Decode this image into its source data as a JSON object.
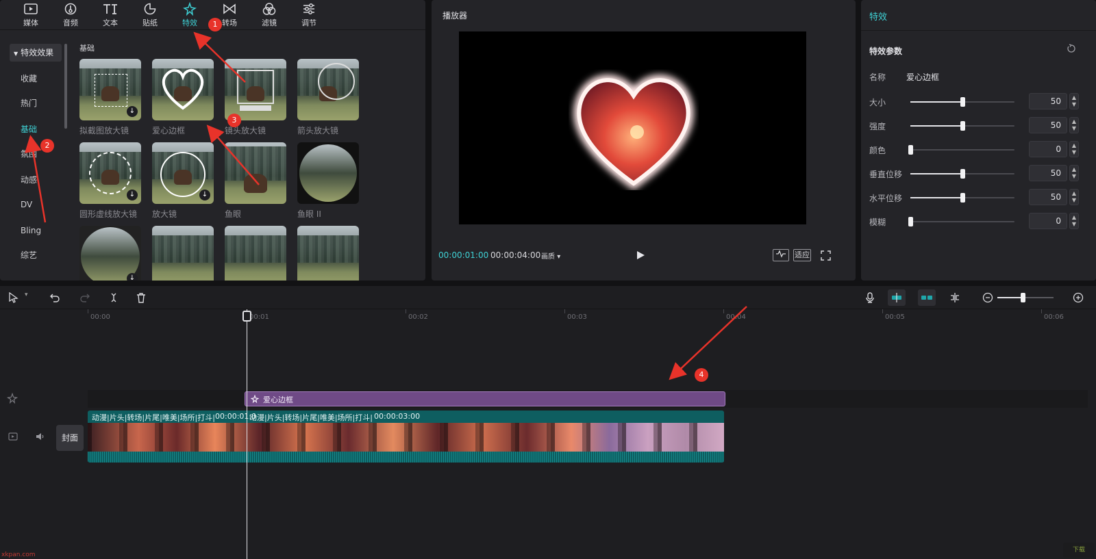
{
  "top_tabs": [
    {
      "label": "媒体",
      "icon": "media-icon"
    },
    {
      "label": "音频",
      "icon": "audio-icon"
    },
    {
      "label": "文本",
      "icon": "text-icon"
    },
    {
      "label": "贴纸",
      "icon": "sticker-icon"
    },
    {
      "label": "特效",
      "icon": "effects-icon",
      "active": true
    },
    {
      "label": "转场",
      "icon": "transition-icon"
    },
    {
      "label": "滤镜",
      "icon": "filter-icon"
    },
    {
      "label": "调节",
      "icon": "adjust-icon"
    }
  ],
  "sidebar": {
    "header": "特效效果",
    "items": [
      "收藏",
      "热门",
      "基础",
      "氛围",
      "动感",
      "DV",
      "Bling",
      "综艺"
    ],
    "active": "基础"
  },
  "effects_grid": {
    "section_title": "基础",
    "cards": [
      {
        "label": "拟截图放大镜",
        "downloadable": true
      },
      {
        "label": "爱心边框",
        "downloadable": false
      },
      {
        "label": "镜头放大镜",
        "downloadable": false
      },
      {
        "label": "箭头放大镜",
        "downloadable": false
      },
      {
        "label": "圆形虚线放大镜",
        "downloadable": true
      },
      {
        "label": "放大镜",
        "downloadable": true
      },
      {
        "label": "鱼眼",
        "downloadable": false
      },
      {
        "label": "鱼眼 II",
        "downloadable": false
      },
      {
        "label": "",
        "downloadable": true
      },
      {
        "label": "",
        "downloadable": false
      },
      {
        "label": "",
        "downloadable": false
      },
      {
        "label": "",
        "downloadable": false
      }
    ]
  },
  "player": {
    "title": "播放器",
    "current_time": "00:00:01:00",
    "total_time": "00:00:04:00",
    "quality_label": "画质",
    "fit_label": "适应"
  },
  "effect_panel": {
    "title": "特效",
    "section_title": "特效参数",
    "name_label": "名称",
    "name_value": "爱心边框",
    "params": [
      {
        "label": "大小",
        "value": "50",
        "level": 0.5
      },
      {
        "label": "强度",
        "value": "50",
        "level": 0.5
      },
      {
        "label": "颜色",
        "value": "0",
        "level": 0
      },
      {
        "label": "垂直位移",
        "value": "50",
        "level": 0.5
      },
      {
        "label": "水平位移",
        "value": "50",
        "level": 0.5
      },
      {
        "label": "模糊",
        "value": "0",
        "level": 0
      }
    ]
  },
  "timeline": {
    "ruler": [
      "00:00",
      "00:01",
      "00:02",
      "00:03",
      "00:04",
      "00:05",
      "00:06"
    ],
    "effect_clip_label": "爱心边框",
    "video_clip_titles": [
      "动漫|片头|转场|片尾|唯美|场所|打斗|",
      "00:00:01:0",
      "动漫|片头|转场|片尾|唯美|场所|打斗|",
      "00:00:03:00"
    ],
    "cover_label": "封面",
    "zoom_level": 0.45
  },
  "annotations": [
    "1",
    "2",
    "3",
    "4"
  ],
  "watermarks": [
    "xkpan.com",
    "下载"
  ],
  "colors": {
    "accent": "#3fd2d6",
    "effect_clip": "#6f4a86",
    "video_clip": "#0e5e60",
    "badge": "#e8332a"
  }
}
